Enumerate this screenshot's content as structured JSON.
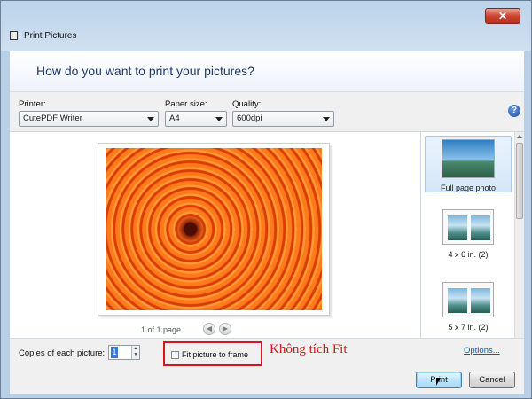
{
  "window": {
    "title": "Print Pictures",
    "close_glyph": "✕"
  },
  "header": {
    "question": "How do you want to print your pictures?"
  },
  "settings": {
    "printer_label": "Printer:",
    "printer_value": "CutePDF Writer",
    "paper_label": "Paper size:",
    "paper_value": "A4",
    "quality_label": "Quality:",
    "quality_value": "600dpi",
    "help_glyph": "?"
  },
  "preview": {
    "page_count": "1 of 1 page",
    "prev_glyph": "◀",
    "next_glyph": "▶"
  },
  "layouts": [
    {
      "label": "Full page photo",
      "icon": "landscape-photo-icon"
    },
    {
      "label": "4 x 6 in. (2)",
      "icon": "two-photos-icon"
    },
    {
      "label": "5 x 7 in. (2)",
      "icon": "two-photos-icon"
    }
  ],
  "bottom": {
    "copies_label": "Copies of each picture:",
    "copies_value": "1",
    "spin_up": "▲",
    "spin_down": "▼",
    "fit_label": "Fit picture to frame",
    "annotation": "Không tích Fit",
    "options_link": "Options...",
    "print_button": "Print",
    "cancel_button": "Cancel"
  },
  "colors": {
    "annotation": "#d9141c",
    "accent": "#3875d7"
  }
}
